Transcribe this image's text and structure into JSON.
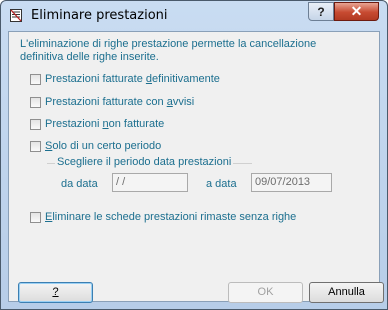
{
  "window": {
    "title": "Eliminare prestazioni",
    "help_label": "?",
    "close_label": "✕"
  },
  "description": "L'eliminazione di righe prestazione permette la cancellazione definitiva delle righe inserite.",
  "options": {
    "fatturate_definitivamente": {
      "pre": "Prestazioni fatturate ",
      "u": "d",
      "post": "efinitivamente",
      "checked": false
    },
    "fatturate_avvisi": {
      "pre": "Prestazioni fatturate con ",
      "u": "a",
      "post": "vvisi",
      "checked": false
    },
    "non_fatturate": {
      "pre": "Prestazioni ",
      "u": "n",
      "post": "on fatturate",
      "checked": false
    },
    "certo_periodo": {
      "pre": "",
      "u": "S",
      "post": "olo di un certo periodo",
      "checked": false
    },
    "eliminare_schede": {
      "pre": "",
      "u": "E",
      "post": "liminare le schede prestazioni rimaste senza righe",
      "checked": false
    }
  },
  "period": {
    "group_label": "Scegliere il periodo data prestazioni",
    "from_label": "da data",
    "from_value": " / /",
    "to_label": "a data",
    "to_value": "09/07/2013"
  },
  "buttons": {
    "help": "?",
    "ok": "OK",
    "cancel": "Annulla"
  }
}
